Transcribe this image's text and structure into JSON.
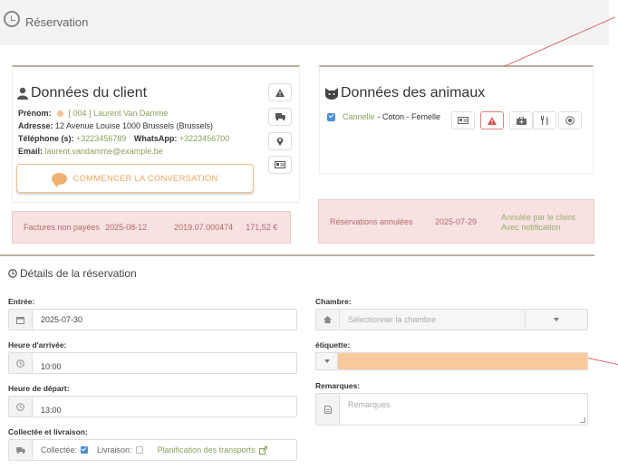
{
  "header": {
    "title": "Réservation"
  },
  "client": {
    "title": "Données du client",
    "prenom_label": "Prénom:",
    "prenom_value": "[ 004 ] Laurent Van Damme",
    "adresse_label": "Adresse:",
    "adresse_value": "12 Avenue Louise  1000  Brussels (Brussels)",
    "telephone_label": "Téléphone (s):",
    "telephone_value": "+3223456789",
    "whatsapp_label": "WhatsApp:",
    "whatsapp_value": "+3223456700",
    "email_label": "Email:",
    "email_value": "laurent.vandamme@example.be",
    "conversation_button": "COMMENCER LA CONVERSATION",
    "side_icons": [
      "warning-icon",
      "truck-icon",
      "map-marker-icon",
      "id-card-icon"
    ]
  },
  "unpaid": {
    "label": "Factures non payées",
    "date": "2025-08-12",
    "number": "2019.07.000474",
    "amount": "171,52 €"
  },
  "animals": {
    "title": "Données des animaux",
    "pet_name": "Cannelle",
    "pet_details": "- Coton - Femelle",
    "checked": true,
    "icons": [
      "id-card-icon",
      "warning-icon",
      "medkit-icon",
      "food-icon",
      "ball-icon"
    ]
  },
  "cancelled": {
    "label": "Réservations annulées",
    "date": "2025-07-29",
    "note": "Annulée par le client. Avec notification"
  },
  "details": {
    "title": "Détails de la réservation",
    "entree_label": "Entrée:",
    "entree_value": "2025-07-30",
    "arrivee_label": "Heure d'arrivée:",
    "arrivee_value": "10:00",
    "depart_label": "Heure de départ:",
    "depart_value": "13:00",
    "collecte_label": "Collectée et livraison:",
    "collectee_text": "Collectée:",
    "collectee_checked": true,
    "livraison_text": "Livraison:",
    "livraison_checked": false,
    "planification_link": "Planification des transports",
    "chambre_label": "Chambre:",
    "chambre_placeholder": "Sélectionner la chambre",
    "etiquette_label": "étiquette:",
    "etiquette_color": "#f9c99b",
    "remarques_label": "Remarques:",
    "remarques_placeholder": "Remarques"
  },
  "colors": {
    "accent_green": "#8aa35a",
    "accent_orange": "#f0a860",
    "alert_pink": "#f7e1e1",
    "panel_border": "#b9b29d"
  }
}
